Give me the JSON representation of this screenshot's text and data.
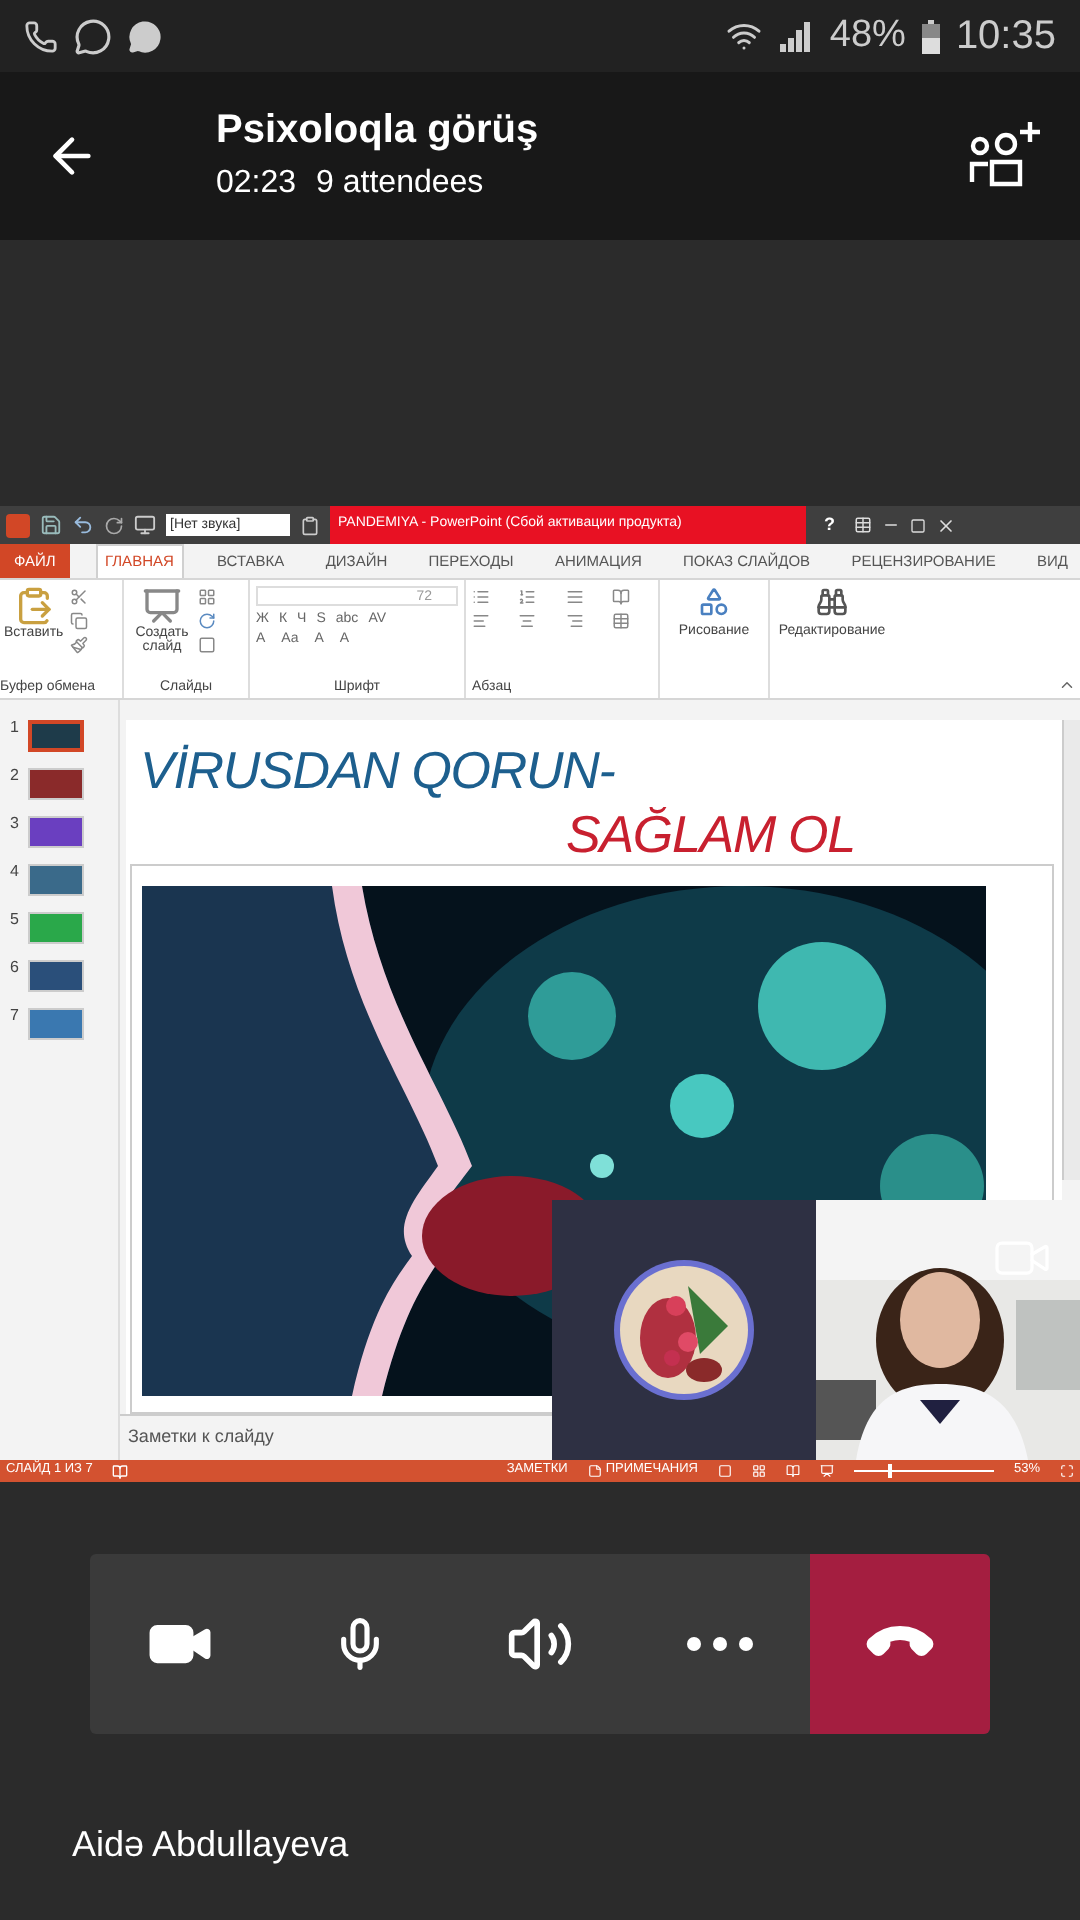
{
  "status_bar": {
    "battery": "48%",
    "time": "10:35"
  },
  "call_header": {
    "title": "Psixoloqla görüş",
    "duration": "02:23",
    "attendees": "9 attendees"
  },
  "shared_screen": {
    "title_bar": {
      "font_box": "[Нет звука]",
      "title": "PANDEMIYA - PowerPoint (Сбой активации продукта)",
      "help": "?"
    },
    "tabs": [
      {
        "label": "ФАЙЛ",
        "kind": "file",
        "selected": false
      },
      {
        "label": "ГЛАВНАЯ",
        "kind": "tab",
        "selected": true
      },
      {
        "label": "ВСТАВКА",
        "kind": "tab",
        "selected": false
      },
      {
        "label": "ДИЗАЙН",
        "kind": "tab",
        "selected": false
      },
      {
        "label": "ПЕРЕХОДЫ",
        "kind": "tab",
        "selected": false
      },
      {
        "label": "АНИМАЦИЯ",
        "kind": "tab",
        "selected": false
      },
      {
        "label": "ПОКАЗ СЛАЙДОВ",
        "kind": "tab",
        "selected": false
      },
      {
        "label": "РЕЦЕНЗИРОВАНИЕ",
        "kind": "tab",
        "selected": false
      },
      {
        "label": "ВИД",
        "kind": "tab",
        "selected": false
      }
    ],
    "ribbon": {
      "paste": "Вставить",
      "clipboard_group": "Буфер обмена",
      "new_slide": "Создать слайд",
      "slides_group": "Слайды",
      "font_size": "72",
      "format_row_1": [
        "Ж",
        "К",
        "Ч",
        "S",
        "abc",
        "AV"
      ],
      "format_row_2": [
        "A",
        "Aa",
        "A",
        "A"
      ],
      "font_group": "Шрифт",
      "paragraph_group": "Абзац",
      "drawing": "Рисование",
      "editing": "Редактирование"
    },
    "slides": [
      {
        "number": "1",
        "selected": true,
        "color": "#1e3b4a"
      },
      {
        "number": "2",
        "selected": false,
        "color": "#8a2a2a"
      },
      {
        "number": "3",
        "selected": false,
        "color": "#6a3fc0"
      },
      {
        "number": "4",
        "selected": false,
        "color": "#3a6a8a"
      },
      {
        "number": "5",
        "selected": false,
        "color": "#2aa84a"
      },
      {
        "number": "6",
        "selected": false,
        "color": "#2a4f7a"
      },
      {
        "number": "7",
        "selected": false,
        "color": "#3a78b0"
      }
    ],
    "slide": {
      "title_line_1": "VİRUSDAN QORUN-",
      "title_line_2": "SAĞLAM OL"
    },
    "notes_placeholder": "Заметки к слайду",
    "ppt_status": {
      "slide_counter": "СЛАЙД 1 ИЗ 7",
      "notes": "ЗАМЕТКИ",
      "comments": "ПРИМЕЧАНИЯ",
      "zoom": "53%",
      "level": 0.24
    }
  },
  "controls": [
    {
      "kind": "camera"
    },
    {
      "kind": "mic"
    },
    {
      "kind": "speaker"
    },
    {
      "kind": "more"
    },
    {
      "kind": "hangup"
    }
  ],
  "presenter": "Aidə Abdullayeva"
}
